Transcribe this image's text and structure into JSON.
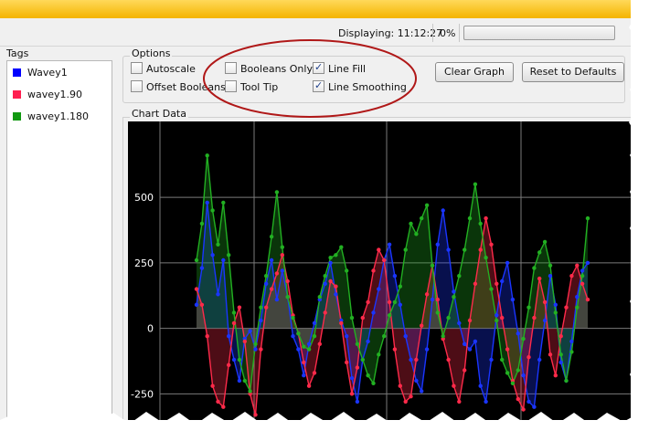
{
  "status": {
    "displaying_label": "Displaying:",
    "time": "11:12:27",
    "progress_text": "0%",
    "progress_value": 0
  },
  "tags": {
    "title": "Tags",
    "items": [
      {
        "label": "Wavey1",
        "color": "#0000ff"
      },
      {
        "label": "wavey1.90",
        "color": "#ff2050"
      },
      {
        "label": "wavey1.180",
        "color": "#119911"
      }
    ]
  },
  "options": {
    "title": "Options",
    "autoscale": {
      "label": "Autoscale",
      "checked": false
    },
    "offset_booleans": {
      "label": "Offset Booleans",
      "checked": false
    },
    "booleans_only": {
      "label": "Booleans Only",
      "checked": false
    },
    "tool_tip": {
      "label": "Tool Tip",
      "checked": false
    },
    "line_fill": {
      "label": "Line Fill",
      "checked": true
    },
    "line_smoothing": {
      "label": "Line Smoothing",
      "checked": true
    },
    "clear_graph": "Clear Graph",
    "reset_defaults": "Reset to Defaults"
  },
  "chart_data": {
    "title": "Chart Data",
    "type": "area",
    "yticks": [
      500,
      250,
      0,
      -250
    ],
    "ylim": [
      -350,
      790
    ],
    "background": "#000000",
    "grid": true,
    "x": [
      0,
      1,
      2,
      3,
      4,
      5,
      6,
      7,
      8,
      9,
      10,
      11,
      12,
      13,
      14,
      15,
      16,
      17,
      18,
      19,
      20,
      21,
      22,
      23,
      24,
      25,
      26,
      27,
      28,
      29,
      30,
      31,
      32,
      33,
      34,
      35,
      36,
      37,
      38,
      39,
      40,
      41,
      42,
      43,
      44,
      45,
      46,
      47,
      48,
      49,
      50,
      51,
      52,
      53,
      54,
      55,
      56,
      57,
      58,
      59,
      60,
      61,
      62,
      63,
      64,
      65,
      66,
      67,
      68,
      69,
      70,
      71,
      72,
      73
    ],
    "series": [
      {
        "name": "Wavey1",
        "color": "#1a35ff",
        "values": [
          90,
          230,
          480,
          280,
          130,
          260,
          -30,
          -120,
          -200,
          -40,
          -10,
          -80,
          30,
          170,
          260,
          110,
          220,
          120,
          -30,
          -80,
          -180,
          -60,
          20,
          110,
          170,
          250,
          130,
          30,
          -30,
          -190,
          -280,
          -120,
          -50,
          60,
          150,
          260,
          320,
          200,
          90,
          -30,
          -120,
          -200,
          -240,
          -80,
          110,
          320,
          450,
          300,
          140,
          20,
          -60,
          -80,
          -50,
          -220,
          -280,
          -120,
          50,
          180,
          250,
          110,
          -20,
          -180,
          -280,
          -300,
          -120,
          30,
          200,
          90,
          -130,
          -200,
          -50,
          120,
          220,
          250
        ]
      },
      {
        "name": "wavey1.90",
        "color": "#ff2a4a",
        "values": [
          150,
          90,
          -30,
          -220,
          -280,
          -300,
          -140,
          20,
          80,
          -50,
          -250,
          -330,
          -80,
          80,
          150,
          210,
          280,
          180,
          50,
          -20,
          -130,
          -220,
          -170,
          -60,
          60,
          180,
          160,
          20,
          -130,
          -250,
          -150,
          40,
          100,
          220,
          300,
          260,
          100,
          -80,
          -220,
          -280,
          -260,
          -120,
          10,
          130,
          240,
          110,
          -40,
          -120,
          -220,
          -280,
          -160,
          30,
          170,
          300,
          420,
          320,
          170,
          40,
          -80,
          -200,
          -270,
          -310,
          -110,
          40,
          190,
          100,
          -100,
          -180,
          -30,
          80,
          200,
          240,
          170,
          110
        ]
      },
      {
        "name": "wavey1.180",
        "color": "#22b022",
        "values": [
          260,
          400,
          660,
          450,
          320,
          480,
          280,
          60,
          -120,
          -200,
          -240,
          -60,
          80,
          200,
          350,
          520,
          310,
          120,
          40,
          -20,
          -70,
          -80,
          -30,
          120,
          200,
          270,
          280,
          310,
          220,
          40,
          -60,
          -120,
          -180,
          -210,
          -100,
          -30,
          50,
          100,
          160,
          300,
          400,
          360,
          420,
          470,
          240,
          60,
          -30,
          40,
          120,
          200,
          300,
          420,
          550,
          400,
          270,
          150,
          30,
          -120,
          -170,
          -210,
          -160,
          -40,
          80,
          230,
          290,
          330,
          240,
          60,
          -100,
          -200,
          -90,
          80,
          200,
          420
        ]
      }
    ]
  }
}
